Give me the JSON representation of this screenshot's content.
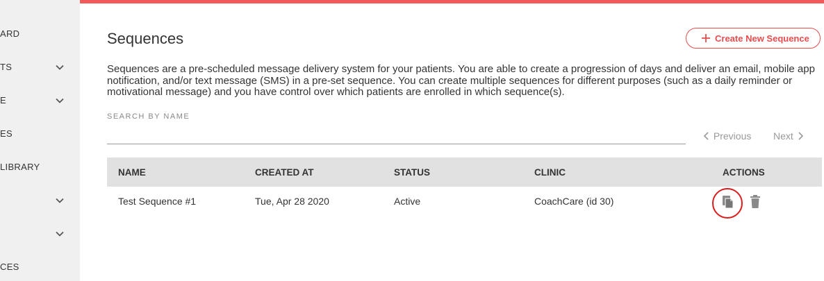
{
  "colors": {
    "accent": "#e84c4c",
    "topbar": "#f05a5a",
    "sidebar_bg": "#f0f0f0",
    "table_header_bg": "#e1e1e1"
  },
  "sidebar": {
    "items": [
      {
        "label": "ARD",
        "has_chevron": false
      },
      {
        "label": "TS",
        "has_chevron": true
      },
      {
        "label": "E",
        "has_chevron": true
      },
      {
        "label": "ES",
        "has_chevron": false
      },
      {
        "label": "LIBRARY",
        "has_chevron": false
      },
      {
        "label": "",
        "has_chevron": true
      },
      {
        "label": "",
        "has_chevron": true
      },
      {
        "label": "CES",
        "has_chevron": false
      }
    ]
  },
  "header": {
    "title": "Sequences",
    "create_button_label": "Create New Sequence",
    "create_button_icon": "plus-icon"
  },
  "description": "Sequences are a pre-scheduled message delivery system for your patients. You are able to create a progression of days and deliver an email, mobile app notification, and/or text message (SMS) in a pre-set sequence. You can create multiple sequences for different purposes (such as a daily reminder or motivational message) and you have control over which patients are enrolled in which sequence(s).",
  "search": {
    "label": "SEARCH BY NAME",
    "value": "",
    "placeholder": ""
  },
  "pagination": {
    "previous_label": "Previous",
    "next_label": "Next"
  },
  "table": {
    "columns": [
      "NAME",
      "CREATED AT",
      "STATUS",
      "CLINIC",
      "ACTIONS"
    ],
    "rows": [
      {
        "name": "Test Sequence #1",
        "created_at": "Tue, Apr 28 2020",
        "status": "Active",
        "clinic": "CoachCare (id 30)",
        "actions": [
          "duplicate-icon",
          "trash-icon"
        ]
      }
    ]
  }
}
